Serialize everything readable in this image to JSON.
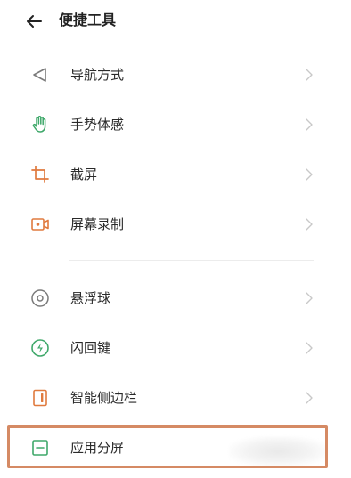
{
  "header": {
    "title": "便捷工具"
  },
  "sections": [
    {
      "items": [
        {
          "label": "导航方式",
          "icon": "navigation-back-triangle-icon"
        },
        {
          "label": "手势体感",
          "icon": "hand-gesture-icon"
        },
        {
          "label": "截屏",
          "icon": "crop-screenshot-icon"
        },
        {
          "label": "屏幕录制",
          "icon": "screen-record-camera-icon"
        }
      ]
    },
    {
      "items": [
        {
          "label": "悬浮球",
          "icon": "floating-ball-icon"
        },
        {
          "label": "闪回键",
          "icon": "flash-return-key-icon"
        },
        {
          "label": "智能侧边栏",
          "icon": "smart-sidebar-icon"
        },
        {
          "label": "应用分屏",
          "icon": "split-screen-icon"
        }
      ]
    }
  ],
  "highlighted_item": "应用分屏",
  "colors": {
    "accent_green": "#3fa86a",
    "accent_orange": "#e07a3e",
    "icon_gray": "#7a7a7a",
    "chevron_gray": "#c8c8c8",
    "highlight_border": "#d58a64"
  }
}
